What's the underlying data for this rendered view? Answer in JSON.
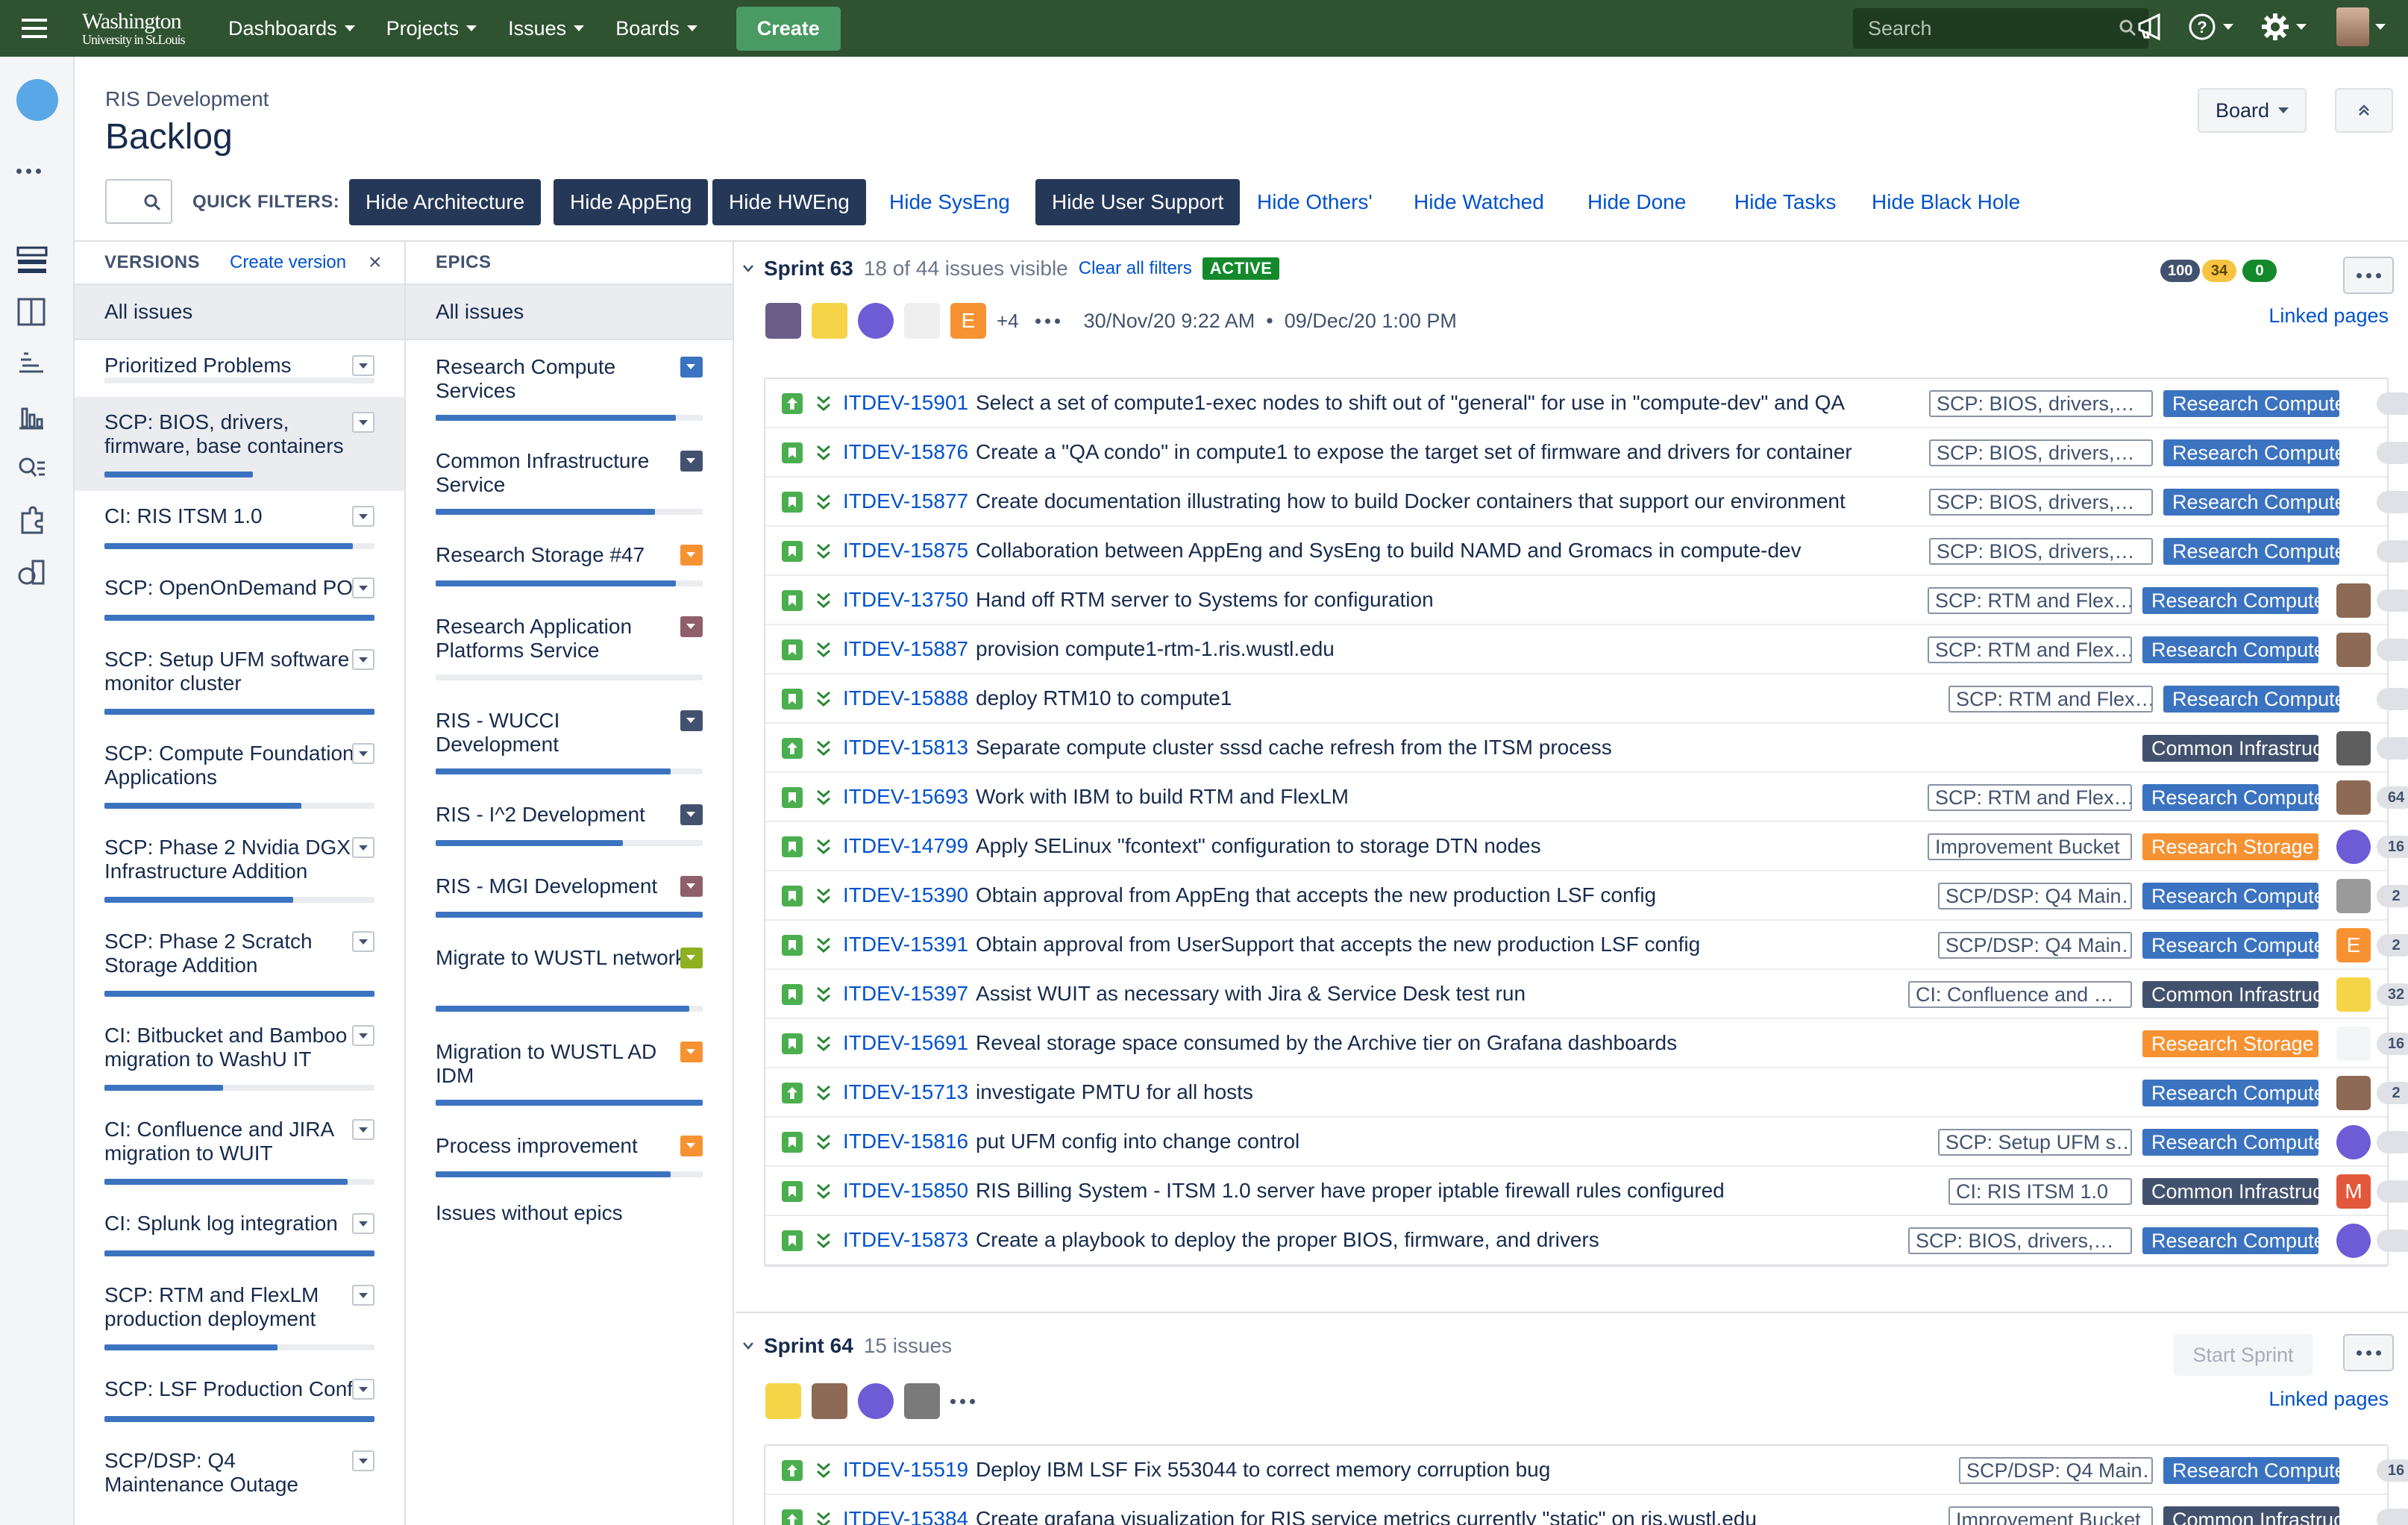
{
  "topnav": {
    "logo_line1": "Washington",
    "logo_line2": "University in St.Louis",
    "items": [
      "Dashboards",
      "Projects",
      "Issues",
      "Boards"
    ],
    "create": "Create",
    "search_placeholder": "Search"
  },
  "header": {
    "project": "RIS Development",
    "title": "Backlog",
    "board_button": "Board"
  },
  "filters": {
    "label": "QUICK FILTERS:",
    "items": [
      {
        "label": "Hide Architecture",
        "active": true
      },
      {
        "label": "Hide AppEng",
        "active": true
      },
      {
        "label": "Hide HWEng",
        "active": true
      },
      {
        "label": "Hide SysEng",
        "active": false
      },
      {
        "label": "Hide User Support",
        "active": true
      },
      {
        "label": "Hide Others'",
        "active": false
      },
      {
        "label": "Hide Watched",
        "active": false
      },
      {
        "label": "Hide Done",
        "active": false
      },
      {
        "label": "Hide Tasks",
        "active": false
      },
      {
        "label": "Hide Black Hole",
        "active": false
      }
    ]
  },
  "versions": {
    "heading": "VERSIONS",
    "create": "Create version",
    "close": "×",
    "all": "All issues",
    "items": [
      {
        "name": "Prioritized Problems",
        "progress": 0
      },
      {
        "name": "SCP: BIOS, drivers, firmware, base containers",
        "progress": 0.55
      },
      {
        "name": "CI: RIS ITSM 1.0",
        "progress": 0.92
      },
      {
        "name": "SCP: OpenOnDemand PO",
        "progress": 1.0
      },
      {
        "name": "SCP: Setup UFM software monitor cluster",
        "progress": 1.0
      },
      {
        "name": "SCP: Compute Foundation Applications",
        "progress": 0.73
      },
      {
        "name": "SCP: Phase 2 Nvidia DGX Infrastructure Addition",
        "progress": 0.7
      },
      {
        "name": "SCP: Phase 2 Scratch Storage Addition",
        "progress": 1.0
      },
      {
        "name": "CI: Bitbucket and Bamboo migration to WashU IT",
        "progress": 0.44
      },
      {
        "name": "CI: Confluence and JIRA migration to WUIT",
        "progress": 0.9
      },
      {
        "name": "CI: Splunk log integration",
        "progress": 1.0
      },
      {
        "name": "SCP: RTM and FlexLM production deployment",
        "progress": 0.64
      },
      {
        "name": "SCP: LSF Production Conf",
        "progress": 1.0
      },
      {
        "name": "SCP/DSP: Q4 Maintenance Outage",
        "progress": 0
      }
    ]
  },
  "epics": {
    "heading": "EPICS",
    "all": "All issues",
    "without": "Issues without epics",
    "items": [
      {
        "name": "Research Compute Services",
        "color": "#3b73c0",
        "progress": 0.9
      },
      {
        "name": "Common Infrastructure Service",
        "color": "#42526e",
        "progress": 0.82
      },
      {
        "name": "Research Storage #47",
        "color": "#f79232",
        "progress": 0.9
      },
      {
        "name": "Research Application Platforms Service",
        "color": "#8f5f6b",
        "progress": 0
      },
      {
        "name": "RIS - WUCCI Development",
        "color": "#42526e",
        "progress": 0.88
      },
      {
        "name": "RIS - I^2 Development",
        "color": "#42526e",
        "progress": 0.7
      },
      {
        "name": "RIS - MGI Development",
        "color": "#8f5f6b",
        "progress": 1.0
      },
      {
        "name": "Migrate to WUSTL network",
        "color": "#8eb021",
        "progress": 0.95
      },
      {
        "name": "Migration to WUSTL AD IDM",
        "color": "#f79232",
        "progress": 1.0
      },
      {
        "name": "Process improvement",
        "color": "#f79232",
        "progress": 0.88
      }
    ]
  },
  "sprint63": {
    "name": "Sprint 63",
    "visible": "18 of 44 issues visible",
    "clear": "Clear all filters",
    "status": "ACTIVE",
    "counts": [
      "100",
      "34",
      "0"
    ],
    "more_assignees": "+4",
    "dates": "30/Nov/20 9:22 AM  •  09/Dec/20 1:00 PM",
    "linked": "Linked pages",
    "issues": [
      {
        "key": "ITDEV-15901",
        "summary": "Select a set of compute1-exec nodes to shift out of \"general\" for use in \"compute-dev\" and QA",
        "version": "SCP: BIOS, drivers,…",
        "epic": "Research Compute …",
        "epic_color": "#3b73c0",
        "assignee": "",
        "est": "",
        "type": "imp"
      },
      {
        "key": "ITDEV-15876",
        "summary": "Create a \"QA condo\" in compute1 to expose the target set of firmware and drivers for container",
        "version": "SCP: BIOS, drivers,…",
        "epic": "Research Compute …",
        "epic_color": "#3b73c0",
        "assignee": "",
        "est": "",
        "type": "story"
      },
      {
        "key": "ITDEV-15877",
        "summary": "Create documentation illustrating how to build Docker containers that support our environment",
        "version": "SCP: BIOS, drivers,…",
        "epic": "Research Compute …",
        "epic_color": "#3b73c0",
        "assignee": "",
        "est": "",
        "type": "story"
      },
      {
        "key": "ITDEV-15875",
        "summary": "Collaboration between AppEng and SysEng to build NAMD and Gromacs in compute-dev",
        "version": "SCP: BIOS, drivers,…",
        "epic": "Research Compute …",
        "epic_color": "#3b73c0",
        "assignee": "",
        "est": "",
        "type": "story"
      },
      {
        "key": "ITDEV-13750",
        "summary": "Hand off RTM server to Systems for configuration",
        "version": "SCP: RTM and Flex…",
        "epic": "Research Compute …",
        "epic_color": "#3b73c0",
        "assignee": "photo",
        "est": "",
        "type": "story"
      },
      {
        "key": "ITDEV-15887",
        "summary": "provision compute1-rtm-1.ris.wustl.edu",
        "version": "SCP: RTM and Flex…",
        "epic": "Research Compute …",
        "epic_color": "#3b73c0",
        "assignee": "photo",
        "est": "",
        "type": "story"
      },
      {
        "key": "ITDEV-15888",
        "summary": "deploy RTM10 to compute1",
        "version": "SCP: RTM and Flex…",
        "epic": "Research Compute …",
        "epic_color": "#3b73c0",
        "assignee": "",
        "est": "",
        "type": "story"
      },
      {
        "key": "ITDEV-15813",
        "summary": "Separate compute cluster sssd cache refresh from the ITSM process",
        "version": "",
        "epic": "Common Infrastruct…",
        "epic_color": "#42526e",
        "assignee": "photo2",
        "est": "",
        "type": "imp"
      },
      {
        "key": "ITDEV-15693",
        "summary": "Work with IBM to build RTM and FlexLM",
        "version": "SCP: RTM and Flex…",
        "epic": "Research Compute …",
        "epic_color": "#3b73c0",
        "assignee": "photo",
        "est": "64",
        "type": "story"
      },
      {
        "key": "ITDEV-14799",
        "summary": "Apply SELinux \"fcontext\" configuration to storage DTN nodes",
        "version": "Improvement Bucket",
        "epic": "Research Storage #…",
        "epic_color": "#f79232",
        "assignee": "robot",
        "est": "16",
        "type": "story"
      },
      {
        "key": "ITDEV-15390",
        "summary": "Obtain approval from AppEng that accepts the new production LSF config",
        "version": "SCP/DSP: Q4 Main…",
        "epic": "Research Compute …",
        "epic_color": "#3b73c0",
        "assignee": "photo3",
        "est": "2",
        "type": "story"
      },
      {
        "key": "ITDEV-15391",
        "summary": "Obtain approval from UserSupport that accepts the new production LSF config",
        "version": "SCP/DSP: Q4 Main…",
        "epic": "Research Compute …",
        "epic_color": "#3b73c0",
        "assignee": "E",
        "est": "2",
        "type": "story"
      },
      {
        "key": "ITDEV-15397",
        "summary": "Assist WUIT as necessary with Jira & Service Desk test run",
        "version": "CI: Confluence and …",
        "epic": "Common Infrastruct…",
        "epic_color": "#42526e",
        "assignee": "cartoon",
        "est": "32",
        "type": "story"
      },
      {
        "key": "ITDEV-15691",
        "summary": "Reveal storage space consumed by the Archive tier on Grafana dashboards",
        "version": "",
        "epic": "Research Storage #…",
        "epic_color": "#f79232",
        "assignee": "bottle",
        "est": "16",
        "type": "story"
      },
      {
        "key": "ITDEV-15713",
        "summary": "investigate PMTU for all hosts",
        "version": "",
        "epic": "Research Compute …",
        "epic_color": "#3b73c0",
        "assignee": "photo",
        "est": "2",
        "type": "imp"
      },
      {
        "key": "ITDEV-15816",
        "summary": "put UFM config into change control",
        "version": "SCP: Setup UFM s…",
        "epic": "Research Compute …",
        "epic_color": "#3b73c0",
        "assignee": "robot",
        "est": "",
        "type": "story"
      },
      {
        "key": "ITDEV-15850",
        "summary": "RIS Billing System - ITSM 1.0 server have proper iptable firewall rules configured",
        "version": "CI: RIS ITSM 1.0",
        "epic": "Common Infrastruct…",
        "epic_color": "#42526e",
        "assignee": "M",
        "est": "",
        "type": "story"
      },
      {
        "key": "ITDEV-15873",
        "summary": "Create a playbook to deploy the proper BIOS, firmware, and drivers",
        "version": "SCP: BIOS, drivers,…",
        "epic": "Research Compute …",
        "epic_color": "#3b73c0",
        "assignee": "robot",
        "est": "",
        "type": "story"
      }
    ]
  },
  "sprint64": {
    "name": "Sprint 64",
    "count": "15 issues",
    "start": "Start Sprint",
    "linked": "Linked pages",
    "issues": [
      {
        "key": "ITDEV-15519",
        "summary": "Deploy IBM LSF Fix 553044 to correct memory corruption bug",
        "version": "SCP/DSP: Q4 Main…",
        "epic": "Research Compute …",
        "epic_color": "#3b73c0",
        "assignee": "",
        "est": "16",
        "type": "imp"
      },
      {
        "key": "ITDEV-15384",
        "summary": "Create grafana visualization for RIS service metrics currently \"static\" on ris.wustl.edu",
        "version": "Improvement Bucket",
        "epic": "Common Infrastruct…",
        "epic_color": "#42526e",
        "assignee": "",
        "est": "",
        "type": "imp"
      }
    ]
  }
}
